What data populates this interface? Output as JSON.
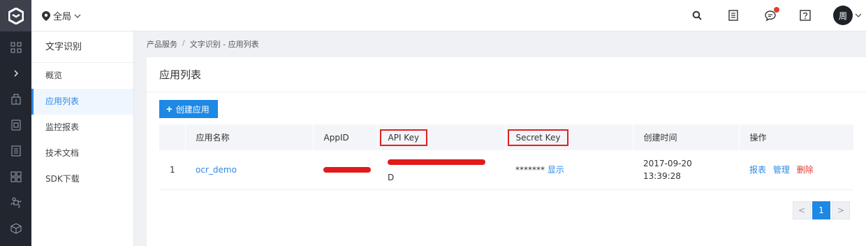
{
  "header": {
    "region_label": "全局",
    "user_avatar_text": "周"
  },
  "sidebar": {
    "title": "文字识别",
    "items": [
      {
        "label": "概览"
      },
      {
        "label": "应用列表"
      },
      {
        "label": "监控报表"
      },
      {
        "label": "技术文档"
      },
      {
        "label": "SDK下载"
      }
    ]
  },
  "breadcrumb": {
    "items": [
      "产品服务",
      "文字识别 - 应用列表"
    ],
    "separator": "/"
  },
  "main": {
    "title": "应用列表",
    "create_button_label": "创建应用",
    "table": {
      "columns": [
        "",
        "应用名称",
        "AppID",
        "API Key",
        "Secret Key",
        "创建时间",
        "操作"
      ],
      "rows": [
        {
          "index": "1",
          "name": "ocr_demo",
          "api_key_tail": "D",
          "secret_masked": "*******",
          "secret_show_label": "显示",
          "created_date": "2017-09-20",
          "created_time": "13:39:28",
          "actions": [
            "报表",
            "管理",
            "删除"
          ]
        }
      ]
    },
    "pagination": {
      "prev": "<",
      "current": "1",
      "next": ">"
    }
  },
  "colors": {
    "accent": "#1e88e5",
    "rail": "#22262e",
    "highlight_box": "#e02020",
    "danger": "#e53935"
  }
}
